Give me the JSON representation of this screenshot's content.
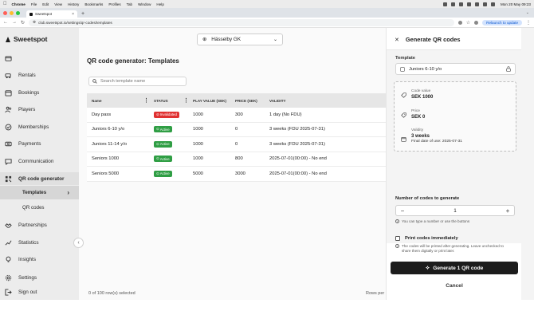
{
  "menubar": {
    "app": "Chrome",
    "items": [
      "File",
      "Edit",
      "View",
      "History",
      "Bookmarks",
      "Profiles",
      "Tab",
      "Window",
      "Help"
    ],
    "clock": "Mon 20 May 09:23"
  },
  "browser": {
    "tab_title": "Sweetspot",
    "url": "club.sweetspot.io/settings/qr-codes/templates",
    "relaunch_label": "Relaunch to update"
  },
  "brand": {
    "name": "Sweetspot"
  },
  "sidebar": {
    "items": [
      {
        "label": "Rentals",
        "icon": "golf-cart-icon"
      },
      {
        "label": "Bookings",
        "icon": "calendar-icon"
      },
      {
        "label": "Players",
        "icon": "people-icon"
      },
      {
        "label": "Memberships",
        "icon": "badge-check-icon"
      },
      {
        "label": "Payments",
        "icon": "money-icon"
      },
      {
        "label": "Communication",
        "icon": "chat-icon"
      },
      {
        "label": "QR code generator",
        "icon": "qr-code-icon"
      },
      {
        "label": "Partnerships",
        "icon": "handshake-icon"
      },
      {
        "label": "Statistics",
        "icon": "chart-icon"
      },
      {
        "label": "Insights",
        "icon": "lightbulb-icon"
      },
      {
        "label": "Settings",
        "icon": "gear-icon"
      },
      {
        "label": "Sign out",
        "icon": "sign-out-icon"
      }
    ],
    "sub_items": [
      "Templates",
      "QR codes"
    ]
  },
  "club_select": {
    "value": "Hässelby GK"
  },
  "main": {
    "title": "QR code generator: Templates",
    "search_placeholder": "Search template name",
    "columns": [
      "Name",
      "STATUS",
      "PLAY VALUE (SEK)",
      "PRICE (SEK)",
      "VALIDITY"
    ],
    "rows": [
      {
        "name": "Day pass",
        "status": "Invalidated",
        "play": "1000",
        "price": "300",
        "validity": "1 day (No FDU)"
      },
      {
        "name": "Juniors 6-10 y/o",
        "status": "Active",
        "play": "1000",
        "price": "0",
        "validity": "3 weeks (FDU 2025-07-31)"
      },
      {
        "name": "Juniors 11-14 y/o",
        "status": "Active",
        "play": "1000",
        "price": "0",
        "validity": "3 weeks (FDU 2025-07-31)"
      },
      {
        "name": "Seniors 1000",
        "status": "Active",
        "play": "1000",
        "price": "800",
        "validity": "2025-07-01(00:00) - No end"
      },
      {
        "name": "Seniors 5000",
        "status": "Active",
        "play": "5000",
        "price": "3000",
        "validity": "2025-07-01(00:00) - No end"
      }
    ],
    "selected_info": "0 of 100 row(s) selected",
    "rows_per_page": "Rows per"
  },
  "panel": {
    "title": "Generate QR codes",
    "template_label": "Template",
    "template_value": "Juniors 6-10 y/o",
    "code_value_label": "Code value",
    "code_value": "SEK 1000",
    "price_label": "Price",
    "price_value": "SEK 0",
    "validity_label": "Validity",
    "validity_value": "3 weeks",
    "final_date": "Final date of use: 2025-07-31",
    "count_label": "Number of codes to generate",
    "count_value": "1",
    "count_hint": "You can type a number or use the buttons",
    "print_label": "Print codes immediately",
    "print_hint": "The codes will be printed after generating. Leave unchecked to share them digitally or print later.",
    "generate_label": "Generate 1 QR code",
    "cancel_label": "Cancel"
  },
  "colors": {
    "invalidated": "#e03131",
    "active": "#2f9e44",
    "primary_button": "#1c1c1c"
  }
}
